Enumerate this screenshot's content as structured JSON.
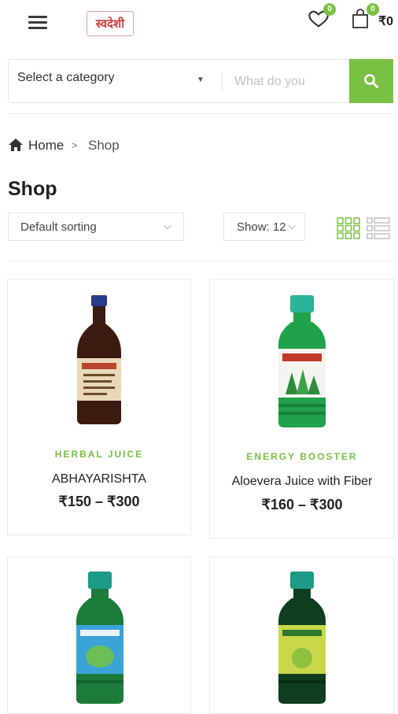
{
  "header": {
    "logo_text": "स्वदेशी",
    "wishlist_count": "0",
    "cart_count": "0",
    "cart_total": "₹0"
  },
  "search": {
    "category_label": "Select a category",
    "placeholder": "What do you"
  },
  "breadcrumb": {
    "home": "Home",
    "separator": ">",
    "current": "Shop"
  },
  "page": {
    "title": "Shop"
  },
  "toolbar": {
    "sort_label": "Default sorting",
    "show_label": "Show: 12"
  },
  "products": [
    {
      "category": "HERBAL JUICE",
      "name": "ABHAYARISHTA",
      "price": "₹150 – ₹300",
      "cap_color": "#2a3a8c",
      "body_color": "#3b1a10",
      "label_color": "#e7d9b8"
    },
    {
      "category": "ENERGY BOOSTER",
      "name": "Aloevera Juice with Fiber",
      "price": "₹160 – ₹300",
      "cap_color": "#2bb39a",
      "body_color": "#1fa24a",
      "label_color": "#c0392b"
    },
    {
      "cap_color": "#1d9b86",
      "body_color": "#1c7a3a",
      "label_color": "#3aa3d8"
    },
    {
      "cap_color": "#1d9b86",
      "body_color": "#0f3d1f",
      "label_color": "#c8d84a"
    }
  ],
  "colors": {
    "accent": "#7ac143"
  }
}
